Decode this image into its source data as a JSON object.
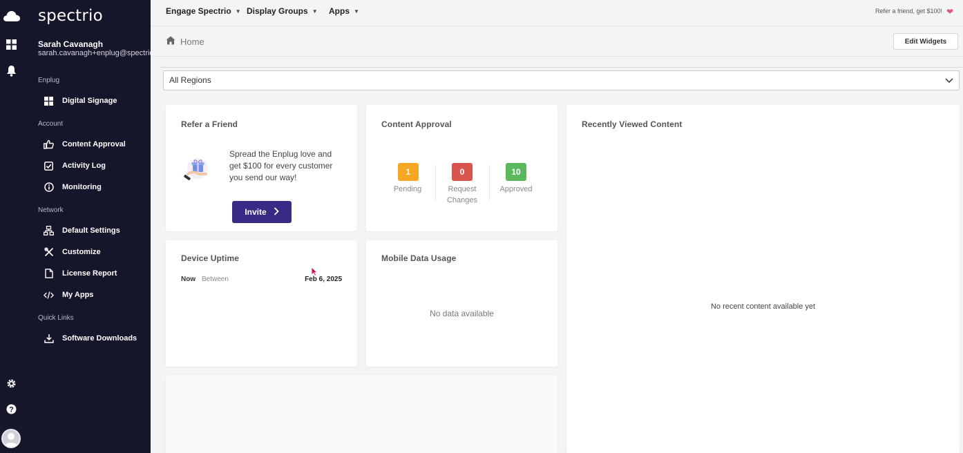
{
  "brand": "spectrio",
  "user": {
    "name": "Sarah Cavanagh",
    "email": "sarah.cavanagh+enplug@spectrio"
  },
  "sidebar": {
    "sections": {
      "enplug": "Enplug",
      "account": "Account",
      "network": "Network",
      "quick_links": "Quick Links"
    },
    "items": {
      "digital_signage": "Digital Signage",
      "content_approval": "Content Approval",
      "activity_log": "Activity Log",
      "monitoring": "Monitoring",
      "default_settings": "Default Settings",
      "customize": "Customize",
      "license_report": "License Report",
      "my_apps": "My Apps",
      "software_downloads": "Software Downloads"
    }
  },
  "topbar": {
    "menus": [
      "Engage Spectrio",
      "Display Groups",
      "Apps"
    ],
    "refer_text": "Refer a friend, get $100!"
  },
  "header": {
    "breadcrumb": "Home",
    "edit_widgets": "Edit Widgets"
  },
  "region_select": {
    "value": "All Regions"
  },
  "widgets": {
    "refer": {
      "title": "Refer a Friend",
      "text": "Spread the Enplug love and get $100 for every customer you send our way!",
      "button": "Invite"
    },
    "approval": {
      "title": "Content Approval",
      "pending": {
        "count": "1",
        "label": "Pending",
        "color": "#f5a623"
      },
      "request": {
        "count": "0",
        "label": "Request Changes",
        "color": "#d9534f"
      },
      "approved": {
        "count": "10",
        "label": "Approved",
        "color": "#5cb85c"
      }
    },
    "recent": {
      "title": "Recently Viewed Content",
      "empty": "No recent content available yet"
    },
    "uptime": {
      "title": "Device Uptime",
      "now": "Now",
      "between": "Between",
      "date": "Feb 6, 2025"
    },
    "mobile": {
      "title": "Mobile Data Usage",
      "empty": "No data available"
    }
  },
  "colors": {
    "sidebar_bg": "#16162a",
    "invite_bg": "#3a2a85",
    "heart": "#e05a6a"
  }
}
